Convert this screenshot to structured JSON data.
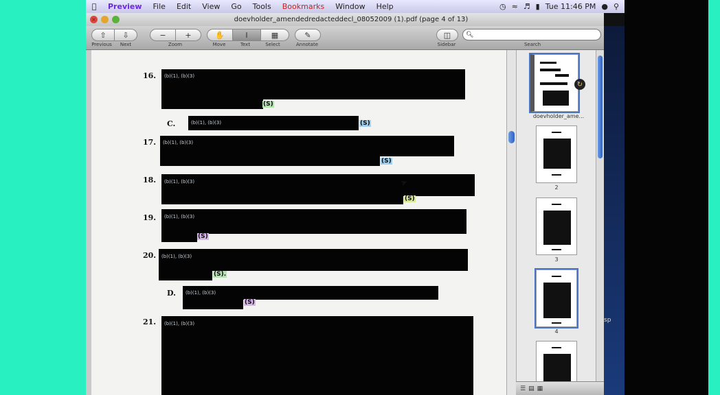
{
  "menubar": {
    "items": [
      "Preview",
      "File",
      "Edit",
      "View",
      "Go",
      "Tools",
      "Bookmarks",
      "Window",
      "Help"
    ],
    "clock": "Tue 11:46 PM"
  },
  "window": {
    "title": "doevholder_amendedredacteddecl_08052009 (1).pdf (page 4 of 13)"
  },
  "toolbar": {
    "labels": [
      "Previous",
      "Next",
      "Zoom",
      "Move",
      "Text",
      "Select",
      "Annotate",
      "Sidebar",
      "Search"
    ]
  },
  "document": {
    "paragraphs": [
      {
        "num": "16.",
        "code": "(b)(1), (b)(3)",
        "mark": "(S)"
      },
      {
        "num": "C.",
        "code": "(b)(1), (b)(3)",
        "mark": "(S)"
      },
      {
        "num": "17.",
        "code": "(b)(1), (b)(3)",
        "mark": "(S)"
      },
      {
        "num": "18.",
        "code": "(b)(1), (b)(3)",
        "mark": "(S)"
      },
      {
        "num": "19.",
        "code": "(b)(1), (b)(3)",
        "mark": "(S)"
      },
      {
        "num": "20.",
        "code": "(b)(1), (b)(3)",
        "mark": "(S)."
      },
      {
        "num": "D.",
        "code": "(b)(1), (b)(3)",
        "mark": "(S)"
      },
      {
        "num": "21.",
        "code": "(b)(1), (b)(3)",
        "mark": ""
      }
    ]
  },
  "sidebar": {
    "thumbs": [
      {
        "label": "doevholder_ame..."
      },
      {
        "label": "2"
      },
      {
        "label": "3"
      },
      {
        "label": "4"
      },
      {
        "label": ""
      }
    ]
  },
  "desktop": {
    "label": "sp"
  }
}
